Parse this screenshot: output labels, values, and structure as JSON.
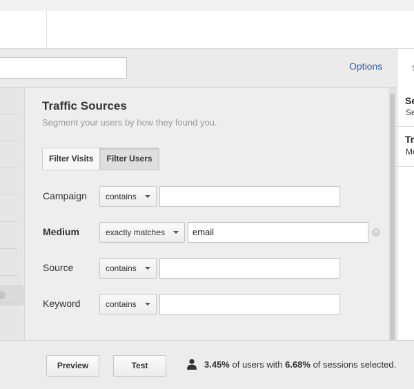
{
  "header": {
    "segment_name_value": "",
    "options_label": "Options"
  },
  "segment": {
    "title": "Traffic Sources",
    "subtitle": "Segment your users by how they found you.",
    "filter_tabs": [
      {
        "label": "Filter Visits",
        "active": false
      },
      {
        "label": "Filter Users",
        "active": true
      }
    ],
    "rows": [
      {
        "label": "Campaign",
        "operator": "contains",
        "value": ""
      },
      {
        "label": "Medium",
        "operator": "exactly matches",
        "value": "email"
      },
      {
        "label": "Source",
        "operator": "contains",
        "value": ""
      },
      {
        "label": "Keyword",
        "operator": "contains",
        "value": ""
      }
    ]
  },
  "summary_panel": {
    "header": "S",
    "items": [
      {
        "title": "Se",
        "subtitle": "Se"
      },
      {
        "title": "Tr",
        "subtitle": "Me"
      }
    ]
  },
  "footer": {
    "preview_label": "Preview",
    "test_label": "Test",
    "users_pct": "3.45%",
    "users_text": " of users with ",
    "sessions_pct": "6.68%",
    "sessions_text": " of sessions selected."
  },
  "colors": {
    "link": "#2a62a8",
    "panel_bg": "#eeeeee",
    "page_bg": "#ebebeb"
  }
}
